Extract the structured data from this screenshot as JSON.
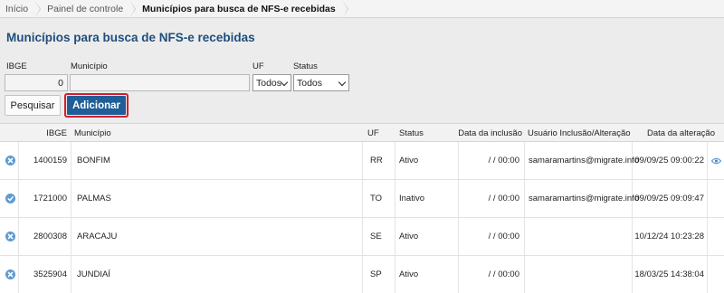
{
  "breadcrumb": [
    "Início",
    "Painel de controle",
    "Municípios para busca de NFS-e recebidas"
  ],
  "page_title": "Municípios para busca de NFS-e recebidas",
  "filters": {
    "ibge_label": "IBGE",
    "ibge_value": "0",
    "municipio_label": "Município",
    "municipio_value": "",
    "uf_label": "UF",
    "uf_value": "Todos",
    "status_label": "Status",
    "status_value": "Todos"
  },
  "buttons": {
    "search": "Pesquisar",
    "add": "Adicionar"
  },
  "table": {
    "headers": {
      "ibge": "IBGE",
      "municipio": "Município",
      "uf": "UF",
      "status": "Status",
      "data_inclusao": "Data da inclusão",
      "usuario": "Usuário Inclusão/Alteração",
      "data_alteracao": "Data da alteração"
    },
    "rows": [
      {
        "icon": "close-circle-icon",
        "ibge": "1400159",
        "municipio": "BONFIM",
        "uf": "RR",
        "status": "Ativo",
        "data_inclusao": "/ / 00:00",
        "usuario": "samaramartins@migrate.info",
        "data_alteracao": "09/09/25 09:00:22",
        "has_view": true
      },
      {
        "icon": "check-circle-icon",
        "ibge": "1721000",
        "municipio": "PALMAS",
        "uf": "TO",
        "status": "Inativo",
        "data_inclusao": "/ / 00:00",
        "usuario": "samaramartins@migrate.info",
        "data_alteracao": "09/09/25 09:09:47",
        "has_view": false
      },
      {
        "icon": "close-circle-icon",
        "ibge": "2800308",
        "municipio": "ARACAJU",
        "uf": "SE",
        "status": "Ativo",
        "data_inclusao": "/ / 00:00",
        "usuario": "",
        "data_alteracao": "10/12/24 10:23:28",
        "has_view": false
      },
      {
        "icon": "close-circle-icon",
        "ibge": "3525904",
        "municipio": "JUNDIAÍ",
        "uf": "SP",
        "status": "Ativo",
        "data_inclusao": "/ / 00:00",
        "usuario": "",
        "data_alteracao": "18/03/25 14:38:04",
        "has_view": false
      }
    ]
  },
  "colors": {
    "accent": "#1e5f97",
    "title": "#1f4e7c",
    "row_icon": "#5d9bd1",
    "add_border": "#d21f2f"
  }
}
